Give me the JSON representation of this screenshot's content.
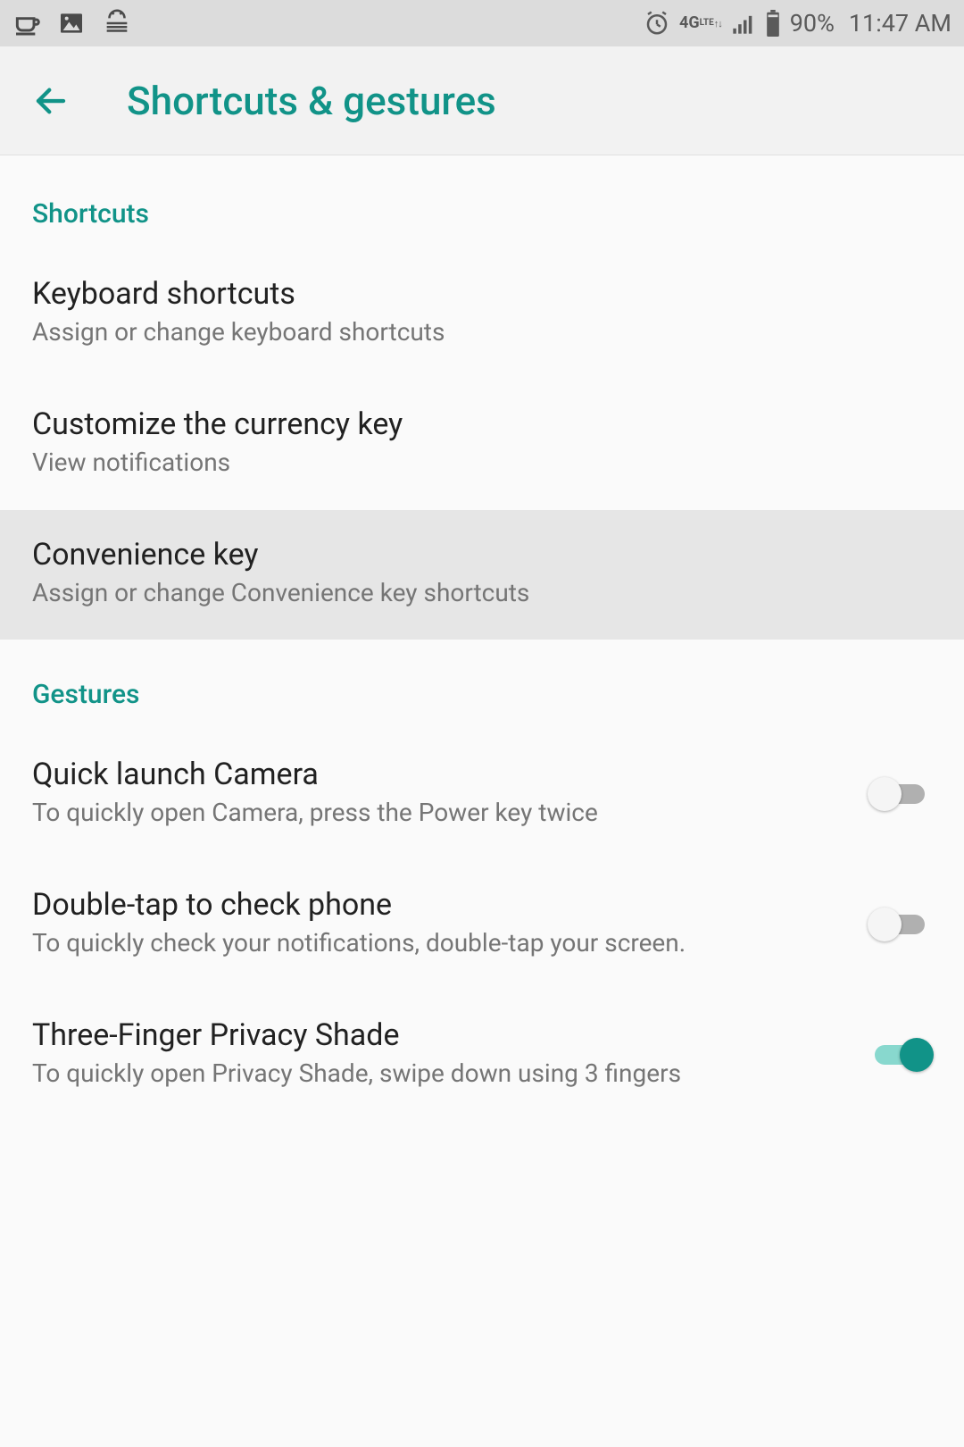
{
  "statusBar": {
    "battery": "90%",
    "time": "11:47 AM",
    "network": "4G"
  },
  "header": {
    "title": "Shortcuts & gestures"
  },
  "sections": {
    "shortcuts": {
      "label": "Shortcuts",
      "items": [
        {
          "title": "Keyboard shortcuts",
          "subtitle": "Assign or change keyboard shortcuts"
        },
        {
          "title": "Customize the currency key",
          "subtitle": "View notifications"
        },
        {
          "title": "Convenience key",
          "subtitle": "Assign or change Convenience key shortcuts"
        }
      ]
    },
    "gestures": {
      "label": "Gestures",
      "items": [
        {
          "title": "Quick launch Camera",
          "subtitle": "To quickly open Camera, press the Power key twice",
          "on": false
        },
        {
          "title": "Double-tap to check phone",
          "subtitle": "To quickly check your notifications, double-tap your screen.",
          "on": false
        },
        {
          "title": "Three-Finger Privacy Shade",
          "subtitle": "To quickly open Privacy Shade, swipe down using 3 fingers",
          "on": true
        }
      ]
    }
  }
}
